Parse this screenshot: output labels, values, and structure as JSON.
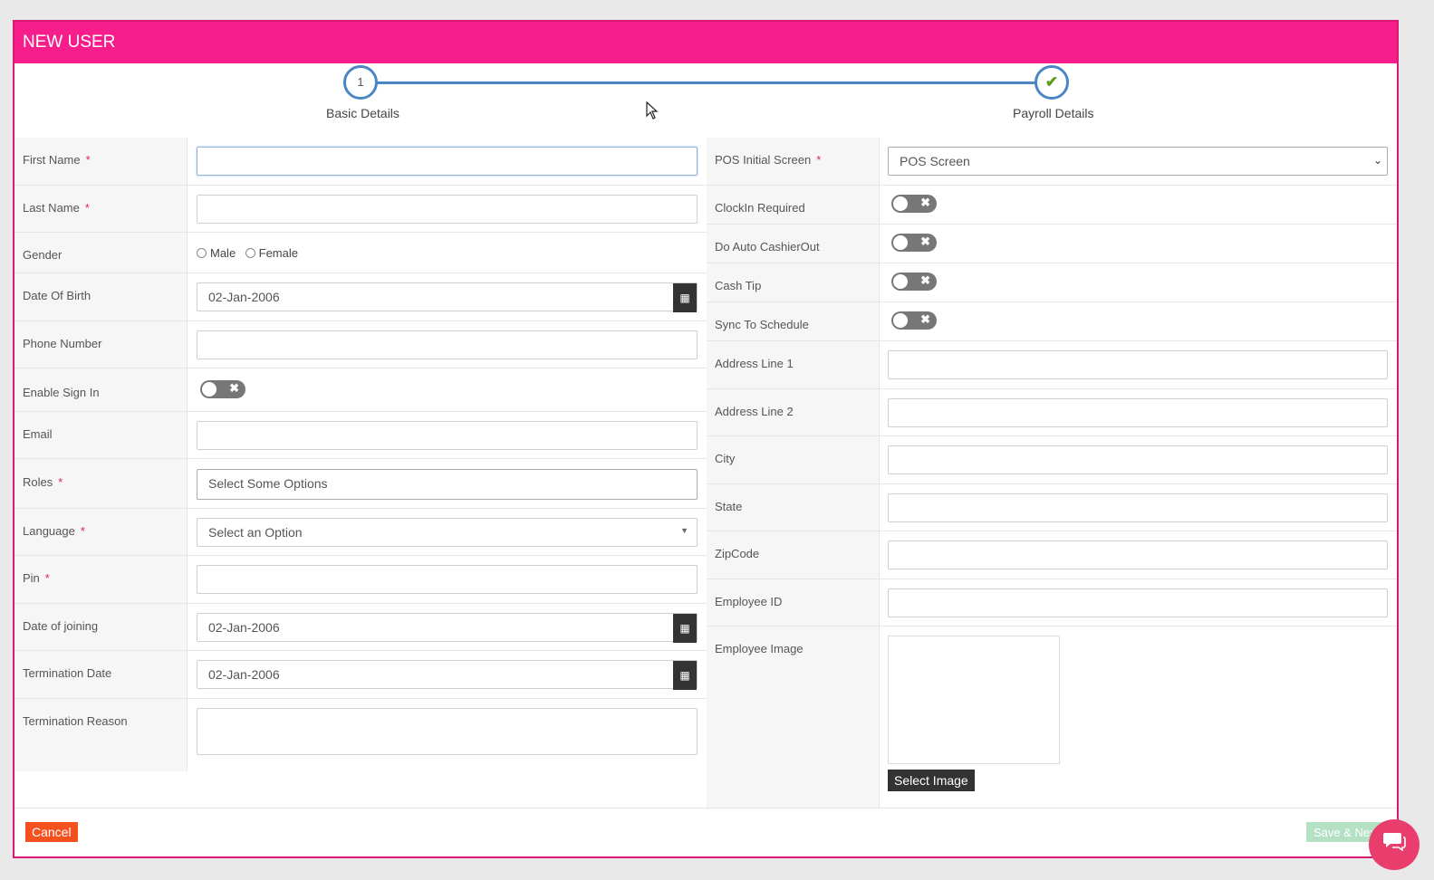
{
  "modal": {
    "title": "NEW USER"
  },
  "stepper": {
    "steps": [
      {
        "number": "1",
        "label": "Basic Details"
      },
      {
        "number": "✔",
        "label": "Payroll Details"
      }
    ]
  },
  "left": {
    "first_name": {
      "label": "First Name",
      "required": "*",
      "value": ""
    },
    "last_name": {
      "label": "Last Name",
      "required": "*",
      "value": ""
    },
    "gender": {
      "label": "Gender",
      "options": [
        "Male",
        "Female"
      ]
    },
    "dob": {
      "label": "Date Of Birth",
      "value": "02-Jan-2006"
    },
    "phone": {
      "label": "Phone Number",
      "value": ""
    },
    "enable_sign_in": {
      "label": "Enable Sign In",
      "state": "off"
    },
    "email": {
      "label": "Email",
      "value": ""
    },
    "roles": {
      "label": "Roles",
      "required": "*",
      "placeholder": "Select Some Options"
    },
    "language": {
      "label": "Language",
      "required": "*",
      "placeholder": "Select an Option"
    },
    "pin": {
      "label": "Pin",
      "required": "*",
      "value": ""
    },
    "joining": {
      "label": "Date of joining",
      "value": "02-Jan-2006"
    },
    "termination": {
      "label": "Termination Date",
      "value": "02-Jan-2006"
    },
    "termination_reason": {
      "label": "Termination Reason",
      "value": ""
    }
  },
  "right": {
    "pos_screen": {
      "label": "POS Initial Screen",
      "required": "*",
      "value": "POS Screen"
    },
    "clockin": {
      "label": "ClockIn Required",
      "state": "off"
    },
    "auto_cashier": {
      "label": "Do Auto CashierOut",
      "state": "off"
    },
    "cash_tip": {
      "label": "Cash Tip",
      "state": "off"
    },
    "sync_schedule": {
      "label": "Sync To Schedule",
      "state": "off"
    },
    "address1": {
      "label": "Address Line 1",
      "value": ""
    },
    "address2": {
      "label": "Address Line 2",
      "value": ""
    },
    "city": {
      "label": "City",
      "value": ""
    },
    "state": {
      "label": "State",
      "value": ""
    },
    "zipcode": {
      "label": "ZipCode",
      "value": ""
    },
    "employee_id": {
      "label": "Employee ID",
      "value": ""
    },
    "employee_image": {
      "label": "Employee Image",
      "button": "Select Image"
    }
  },
  "footer": {
    "cancel": "Cancel",
    "save": "Save & Next"
  },
  "icons": {
    "calendar": "calendar-icon",
    "chat": "chat-icon",
    "toggle_off": "x-icon",
    "check": "check-icon"
  },
  "colors": {
    "header": "#f71e8c",
    "stepper": "#4a86c5",
    "cancel": "#f4511e",
    "save": "#b4e0c4",
    "chat": "#e83d6d"
  }
}
